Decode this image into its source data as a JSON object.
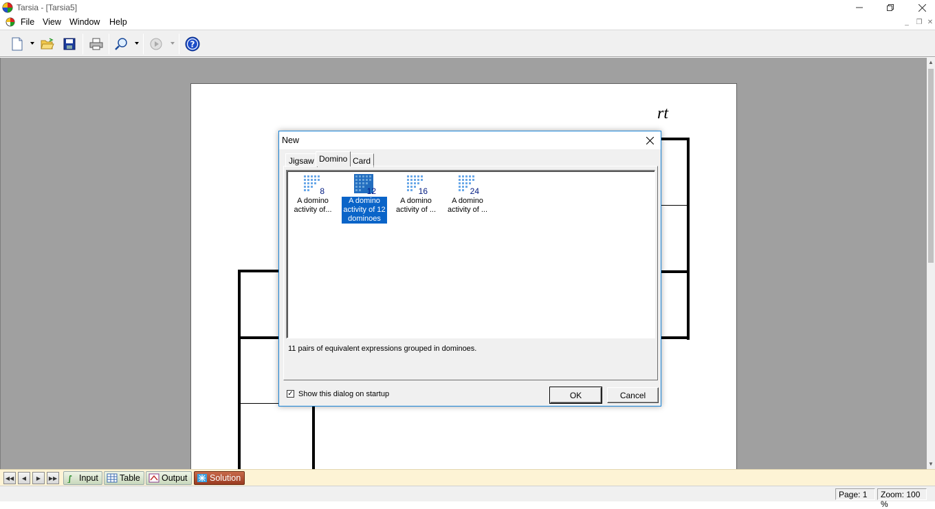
{
  "window": {
    "title": "Tarsia - [Tarsia5]"
  },
  "menu": [
    "File",
    "View",
    "Window",
    "Help"
  ],
  "toolbar": {
    "icons": [
      "new-document-icon",
      "open-folder-icon",
      "save-icon",
      "print-icon",
      "zoom-icon",
      "play-icon",
      "help-icon"
    ]
  },
  "document": {
    "partial_text": "rt"
  },
  "sheet_tabs": [
    "Input",
    "Table",
    "Output",
    "Solution"
  ],
  "status": {
    "page": "Page: 1",
    "zoom": "Zoom: 100 %"
  },
  "dialog": {
    "title": "New",
    "tabs": [
      "Jigsaw",
      "Domino",
      "Card"
    ],
    "active_tab": "Domino",
    "items": [
      {
        "num": "8",
        "label": "A domino activity of..."
      },
      {
        "num": "12",
        "label": "A domino activity of 12 dominoes",
        "selected": true
      },
      {
        "num": "16",
        "label": "A domino activity of ..."
      },
      {
        "num": "24",
        "label": "A domino activity of ..."
      }
    ],
    "description": "11 pairs of equivalent expressions grouped in dominoes.",
    "startup_checkbox_label": "Show this dialog on startup",
    "startup_checked": true,
    "ok_label": "OK",
    "cancel_label": "Cancel"
  },
  "colors": {
    "selection": "#0a64c8",
    "accent_border": "#1883d7",
    "solution_tab": "#9a3a20",
    "workspace": "#a0a0a0"
  }
}
